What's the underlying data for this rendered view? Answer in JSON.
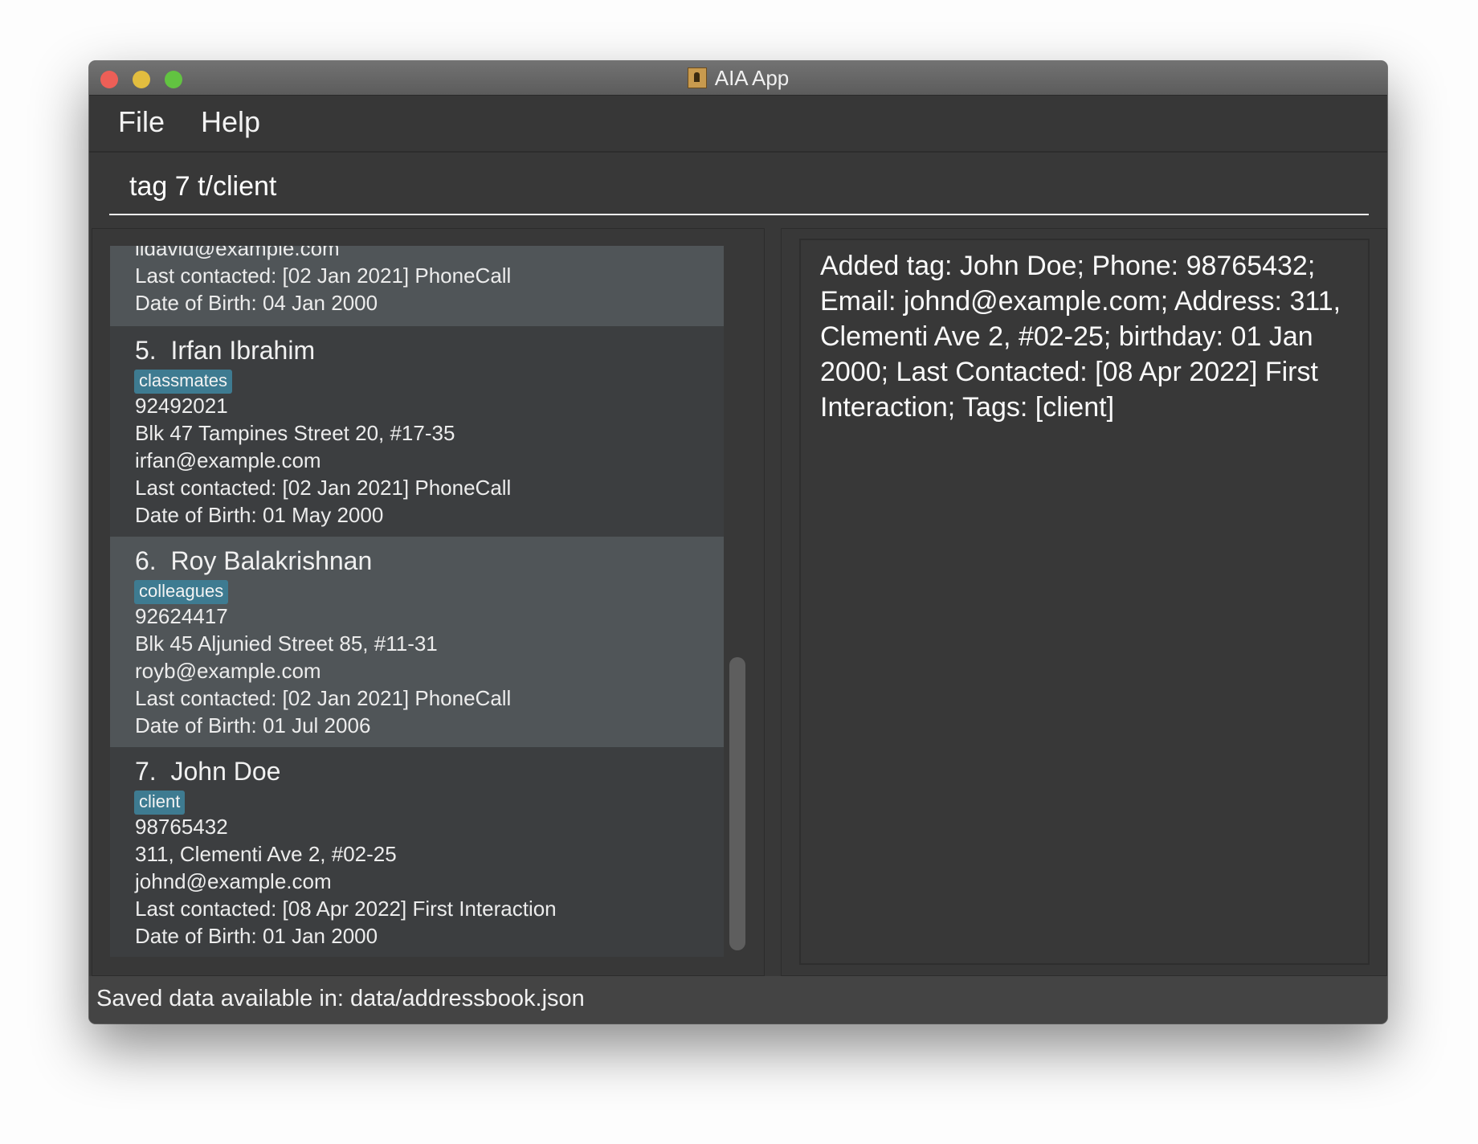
{
  "window": {
    "title": "AIA App",
    "traffic_lights": {
      "close": "#ed5f57",
      "minimize": "#e2bd3f",
      "maximize": "#62c341"
    }
  },
  "menu": {
    "items": [
      "File",
      "Help"
    ]
  },
  "command_box": {
    "value": "tag 7 t/client"
  },
  "person_list": {
    "partial_top": {
      "email": "lidavid@example.com",
      "last_contacted": "Last contacted: [02 Jan 2021] PhoneCall",
      "dob": "Date of Birth: 04 Jan 2000"
    },
    "persons": [
      {
        "index": "5.",
        "name": "Irfan Ibrahim",
        "tag": "classmates",
        "phone": "92492021",
        "address": "Blk 47 Tampines Street 20, #17-35",
        "email": "irfan@example.com",
        "last_contacted": "Last contacted: [02 Jan 2021] PhoneCall",
        "dob": "Date of Birth: 01 May 2000"
      },
      {
        "index": "6.",
        "name": "Roy Balakrishnan",
        "tag": "colleagues",
        "phone": "92624417",
        "address": "Blk 45 Aljunied Street 85, #11-31",
        "email": "royb@example.com",
        "last_contacted": "Last contacted: [02 Jan 2021] PhoneCall",
        "dob": "Date of Birth: 01 Jul 2006"
      },
      {
        "index": "7.",
        "name": "John Doe",
        "tag": "client",
        "phone": "98765432",
        "address": "311, Clementi Ave 2, #02-25",
        "email": "johnd@example.com",
        "last_contacted": "Last contacted: [08 Apr 2022] First Interaction",
        "dob": "Date of Birth: 01 Jan 2000"
      }
    ]
  },
  "result": {
    "text": "Added tag: John Doe; Phone: 98765432; Email: johnd@example.com; Address: 311, Clementi Ave 2, #02-25; birthday: 01 Jan 2000; Last Contacted: [08 Apr 2022] First Interaction; Tags: [client]"
  },
  "status_bar": {
    "text": "Saved data available in: data/addressbook.json"
  },
  "colors": {
    "tag": "#3e7b91",
    "selected_cell": "#505558",
    "cell": "#3c3e40",
    "background": "#383838"
  }
}
